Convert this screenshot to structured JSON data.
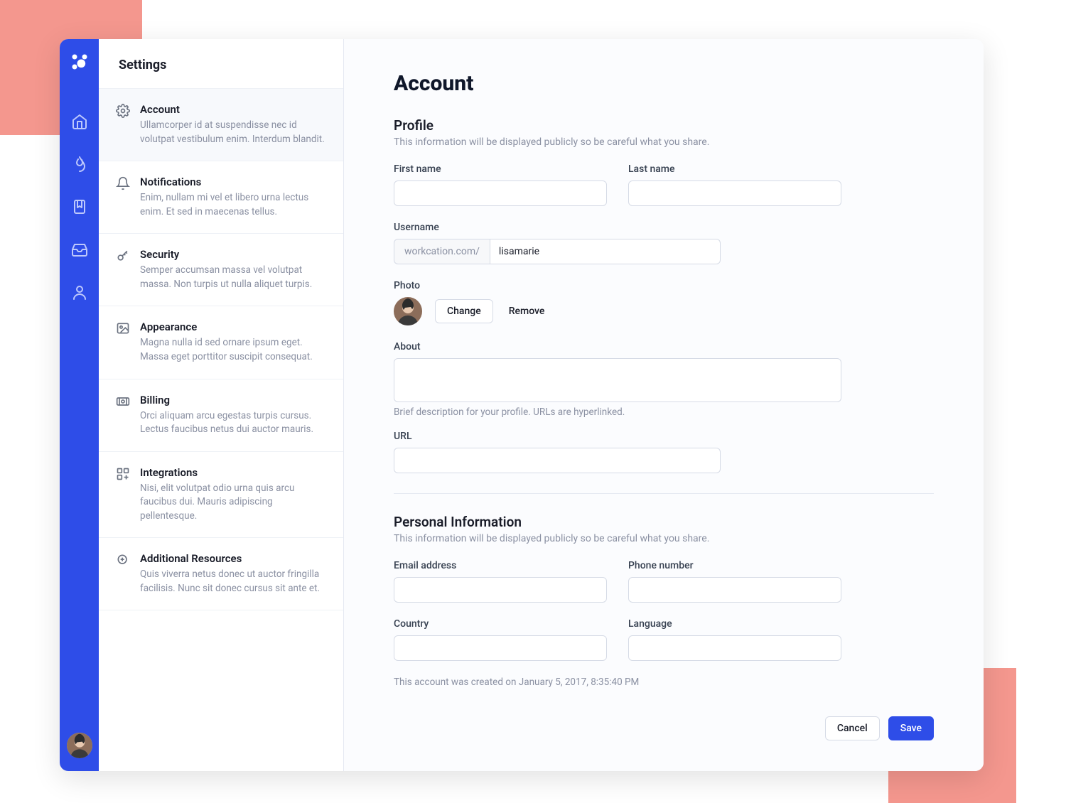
{
  "brand": {
    "color": "#2E4DE8"
  },
  "rail": {
    "icons": [
      "home-icon",
      "flame-icon",
      "bookmark-icon",
      "inbox-icon",
      "user-icon"
    ]
  },
  "sidebar": {
    "title": "Settings",
    "items": [
      {
        "label": "Account",
        "desc": "Ullamcorper id at suspendisse nec id volutpat vestibulum enim. Interdum blandit."
      },
      {
        "label": "Notifications",
        "desc": "Enim, nullam mi vel et libero urna lectus enim. Et sed in maecenas tellus."
      },
      {
        "label": "Security",
        "desc": "Semper accumsan massa vel volutpat massa. Non turpis ut nulla aliquet turpis."
      },
      {
        "label": "Appearance",
        "desc": "Magna nulla id sed ornare ipsum eget. Massa eget porttitor suscipit consequat."
      },
      {
        "label": "Billing",
        "desc": "Orci aliquam arcu egestas turpis cursus. Lectus faucibus netus dui auctor mauris."
      },
      {
        "label": "Integrations",
        "desc": "Nisi, elit volutpat odio urna quis arcu faucibus dui. Mauris adipiscing pellentesque."
      },
      {
        "label": "Additional Resources",
        "desc": "Quis viverra netus donec ut auctor fringilla facilisis. Nunc sit donec cursus sit ante et."
      }
    ]
  },
  "page": {
    "title": "Account",
    "profile": {
      "heading": "Profile",
      "desc": "This information will be displayed publicly so be careful what you share.",
      "first_name_label": "First name",
      "first_name_value": "",
      "last_name_label": "Last name",
      "last_name_value": "",
      "username_label": "Username",
      "username_prefix": "workcation.com/",
      "username_value": "lisamarie",
      "photo_label": "Photo",
      "photo_change": "Change",
      "photo_remove": "Remove",
      "about_label": "About",
      "about_value": "",
      "about_helper": "Brief description for your profile. URLs are hyperlinked.",
      "url_label": "URL",
      "url_value": ""
    },
    "personal": {
      "heading": "Personal Information",
      "desc": "This information will be displayed publicly so be careful what you share.",
      "email_label": "Email address",
      "email_value": "",
      "phone_label": "Phone number",
      "phone_value": "",
      "country_label": "Country",
      "country_value": "",
      "language_label": "Language",
      "language_value": "",
      "created_note": "This account was created on January 5, 2017, 8:35:40 PM"
    },
    "actions": {
      "cancel": "Cancel",
      "save": "Save"
    }
  }
}
